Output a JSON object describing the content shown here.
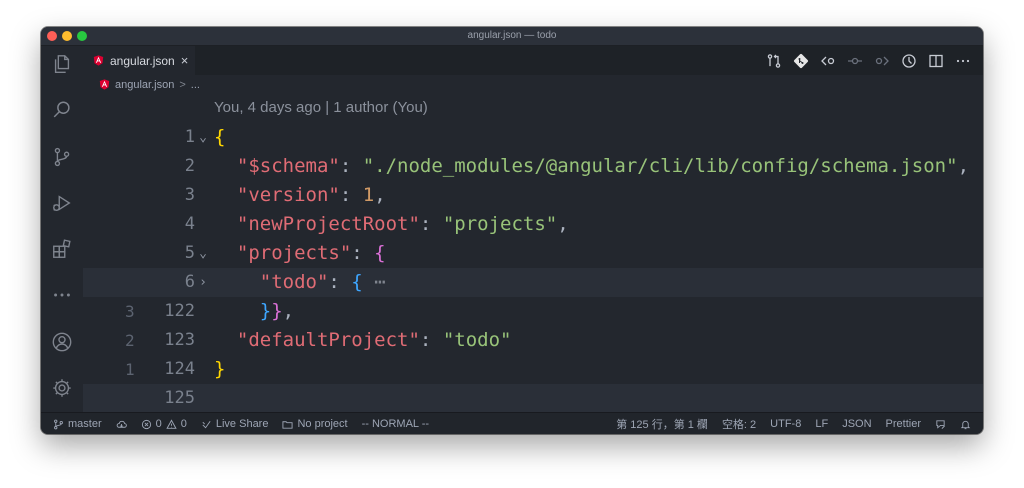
{
  "window": {
    "title": "angular.json — todo"
  },
  "tab": {
    "label": "angular.json",
    "close": "×"
  },
  "breadcrumb": {
    "file": "angular.json",
    "sep": ">",
    "more": "..."
  },
  "blame": "You, 4 days ago | 1 author (You)",
  "gutter": {
    "lines": [
      {
        "rel": "",
        "num": "1",
        "fold": "⌄"
      },
      {
        "rel": "",
        "num": "2",
        "fold": ""
      },
      {
        "rel": "",
        "num": "3",
        "fold": ""
      },
      {
        "rel": "",
        "num": "4",
        "fold": ""
      },
      {
        "rel": "",
        "num": "5",
        "fold": "⌄"
      },
      {
        "rel": "",
        "num": "6",
        "fold": "›"
      },
      {
        "rel": "3",
        "num": "122",
        "fold": ""
      },
      {
        "rel": "2",
        "num": "123",
        "fold": ""
      },
      {
        "rel": "1",
        "num": "124",
        "fold": ""
      },
      {
        "rel": "",
        "num": "125",
        "fold": ""
      }
    ]
  },
  "code": {
    "l1": {
      "brace": "{"
    },
    "l2": {
      "key": "\"$schema\"",
      "colon": ": ",
      "value": "\"./node_modules/@angular/cli/lib/config/schema.json\"",
      "comma": ","
    },
    "l3": {
      "key": "\"version\"",
      "colon": ": ",
      "value": "1",
      "comma": ","
    },
    "l4": {
      "key": "\"newProjectRoot\"",
      "colon": ": ",
      "value": "\"projects\"",
      "comma": ","
    },
    "l5": {
      "key": "\"projects\"",
      "colon": ": ",
      "brace": "{"
    },
    "l6": {
      "key": "\"todo\"",
      "colon": ": ",
      "brace": "{",
      "ellipsis": "⋯"
    },
    "l7": {
      "inner": "}",
      "outer": "}",
      "comma": ","
    },
    "l8": {
      "key": "\"defaultProject\"",
      "colon": ": ",
      "value": "\"todo\""
    },
    "l9": {
      "brace": "}"
    }
  },
  "status": {
    "branch": "master",
    "errors": "0",
    "warnings": "0",
    "live_share": "Live Share",
    "project": "No project",
    "mode": "-- NORMAL --",
    "position": "第 125 行，第 1 欄",
    "spaces": "空格: 2",
    "encoding": "UTF-8",
    "eol": "LF",
    "language": "JSON",
    "formatter": "Prettier"
  },
  "colors": {
    "background": "#23272e",
    "key": "#e06c75",
    "string": "#98c379",
    "number": "#d19a66",
    "bracket_1": "#ffd700",
    "bracket_2": "#da70d6",
    "bracket_3": "#3ea6ff",
    "angular": "#dd0031"
  }
}
